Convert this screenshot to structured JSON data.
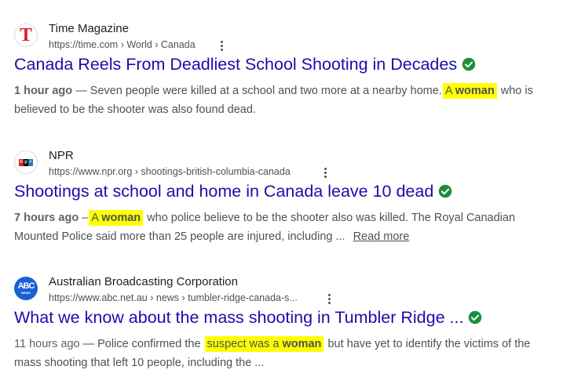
{
  "results": [
    {
      "site_name": "Time Magazine",
      "url": "https://time.com › World › Canada",
      "favicon_letter": "T",
      "title": "Canada Reels From Deadliest School Shooting in Decades",
      "age": "1 hour ago",
      "snippet_before": " — Seven people were killed at a school and two more at a nearby home.",
      "highlight_prefix": "A ",
      "highlight_bold": "woman",
      "snippet_after": " who is believed to be the shooter was also found dead."
    },
    {
      "site_name": "NPR",
      "url": "https://www.npr.org › shootings-british-columbia-canada",
      "favicon_letters": [
        "n",
        "p",
        "r"
      ],
      "favicon_colors": [
        "#d62021",
        "#000000",
        "#237bbd"
      ],
      "title": "Shootings at school and home in Canada leave 10 dead",
      "age": "7 hours ago",
      "dash": " –",
      "highlight_prefix": "A ",
      "highlight_bold": "woman",
      "snippet_after": " who police believe to be the shooter also was killed. The Royal Canadian Mounted Police said more than 25 people are injured, including ...",
      "read_more": "Read more"
    },
    {
      "site_name": "Australian Broadcasting Corporation",
      "url": "https://www.abc.net.au › news › tumbler-ridge-canada-s...",
      "favicon_glyph": "ABC",
      "favicon_sub": "NEWS",
      "title": "What we know about the mass shooting in Tumbler Ridge ...",
      "age": "11 hours ago",
      "snippet_before": " — Police confirmed the ",
      "highlight_plain": "suspect was a ",
      "highlight_bold": "woman",
      "snippet_after": " but have yet to identify the victims of the mass shooting that left 10 people, including the ..."
    }
  ],
  "colors": {
    "link": "#1a0dab",
    "verified": "#1e8e3e",
    "highlight": "#ffff00"
  },
  "icons": {
    "verified": "verified-check-icon",
    "more": "more-options-icon"
  }
}
